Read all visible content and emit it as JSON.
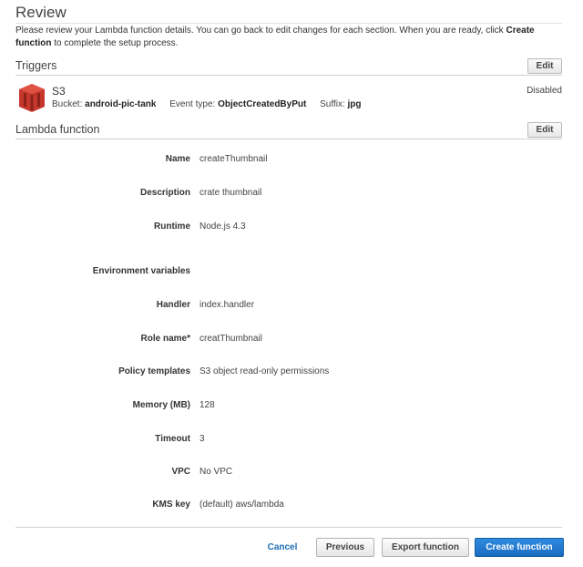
{
  "page": {
    "title": "Review",
    "intro_text": "Please review your Lambda function details. You can go back to edit changes for each section. When you are ready, click ",
    "intro_bold": "Create function",
    "intro_tail": " to complete the setup process."
  },
  "triggers": {
    "section_title": "Triggers",
    "edit_label": "Edit",
    "item": {
      "icon": "s3-bucket-icon",
      "name": "S3",
      "bucket_label": "Bucket:",
      "bucket_value": "android-pic-tank",
      "event_label": "Event type:",
      "event_value": "ObjectCreatedByPut",
      "suffix_label": "Suffix:",
      "suffix_value": "jpg",
      "status": "Disabled",
      "icon_color": "#c7362c"
    }
  },
  "lambda": {
    "section_title": "Lambda function",
    "edit_label": "Edit",
    "fields": [
      {
        "label": "Name",
        "value": "createThumbnail"
      },
      {
        "label": "Description",
        "value": "crate thumbnail"
      },
      {
        "label": "Runtime",
        "value": "Node.js 4.3"
      },
      {
        "label": "Environment variables",
        "value": ""
      },
      {
        "label": "Handler",
        "value": "index.handler"
      },
      {
        "label": "Role name*",
        "value": "creatThumbnail"
      },
      {
        "label": "Policy templates",
        "value": "S3 object read-only permissions"
      },
      {
        "label": "Memory (MB)",
        "value": "128"
      },
      {
        "label": "Timeout",
        "value": "3"
      },
      {
        "label": "VPC",
        "value": "No VPC"
      },
      {
        "label": "KMS key",
        "value": "(default) aws/lambda"
      }
    ]
  },
  "footer": {
    "cancel_label": "Cancel",
    "previous_label": "Previous",
    "export_label": "Export function",
    "create_label": "Create function",
    "primary_color": "#1a6cc0",
    "link_color": "#1f6eb5"
  }
}
